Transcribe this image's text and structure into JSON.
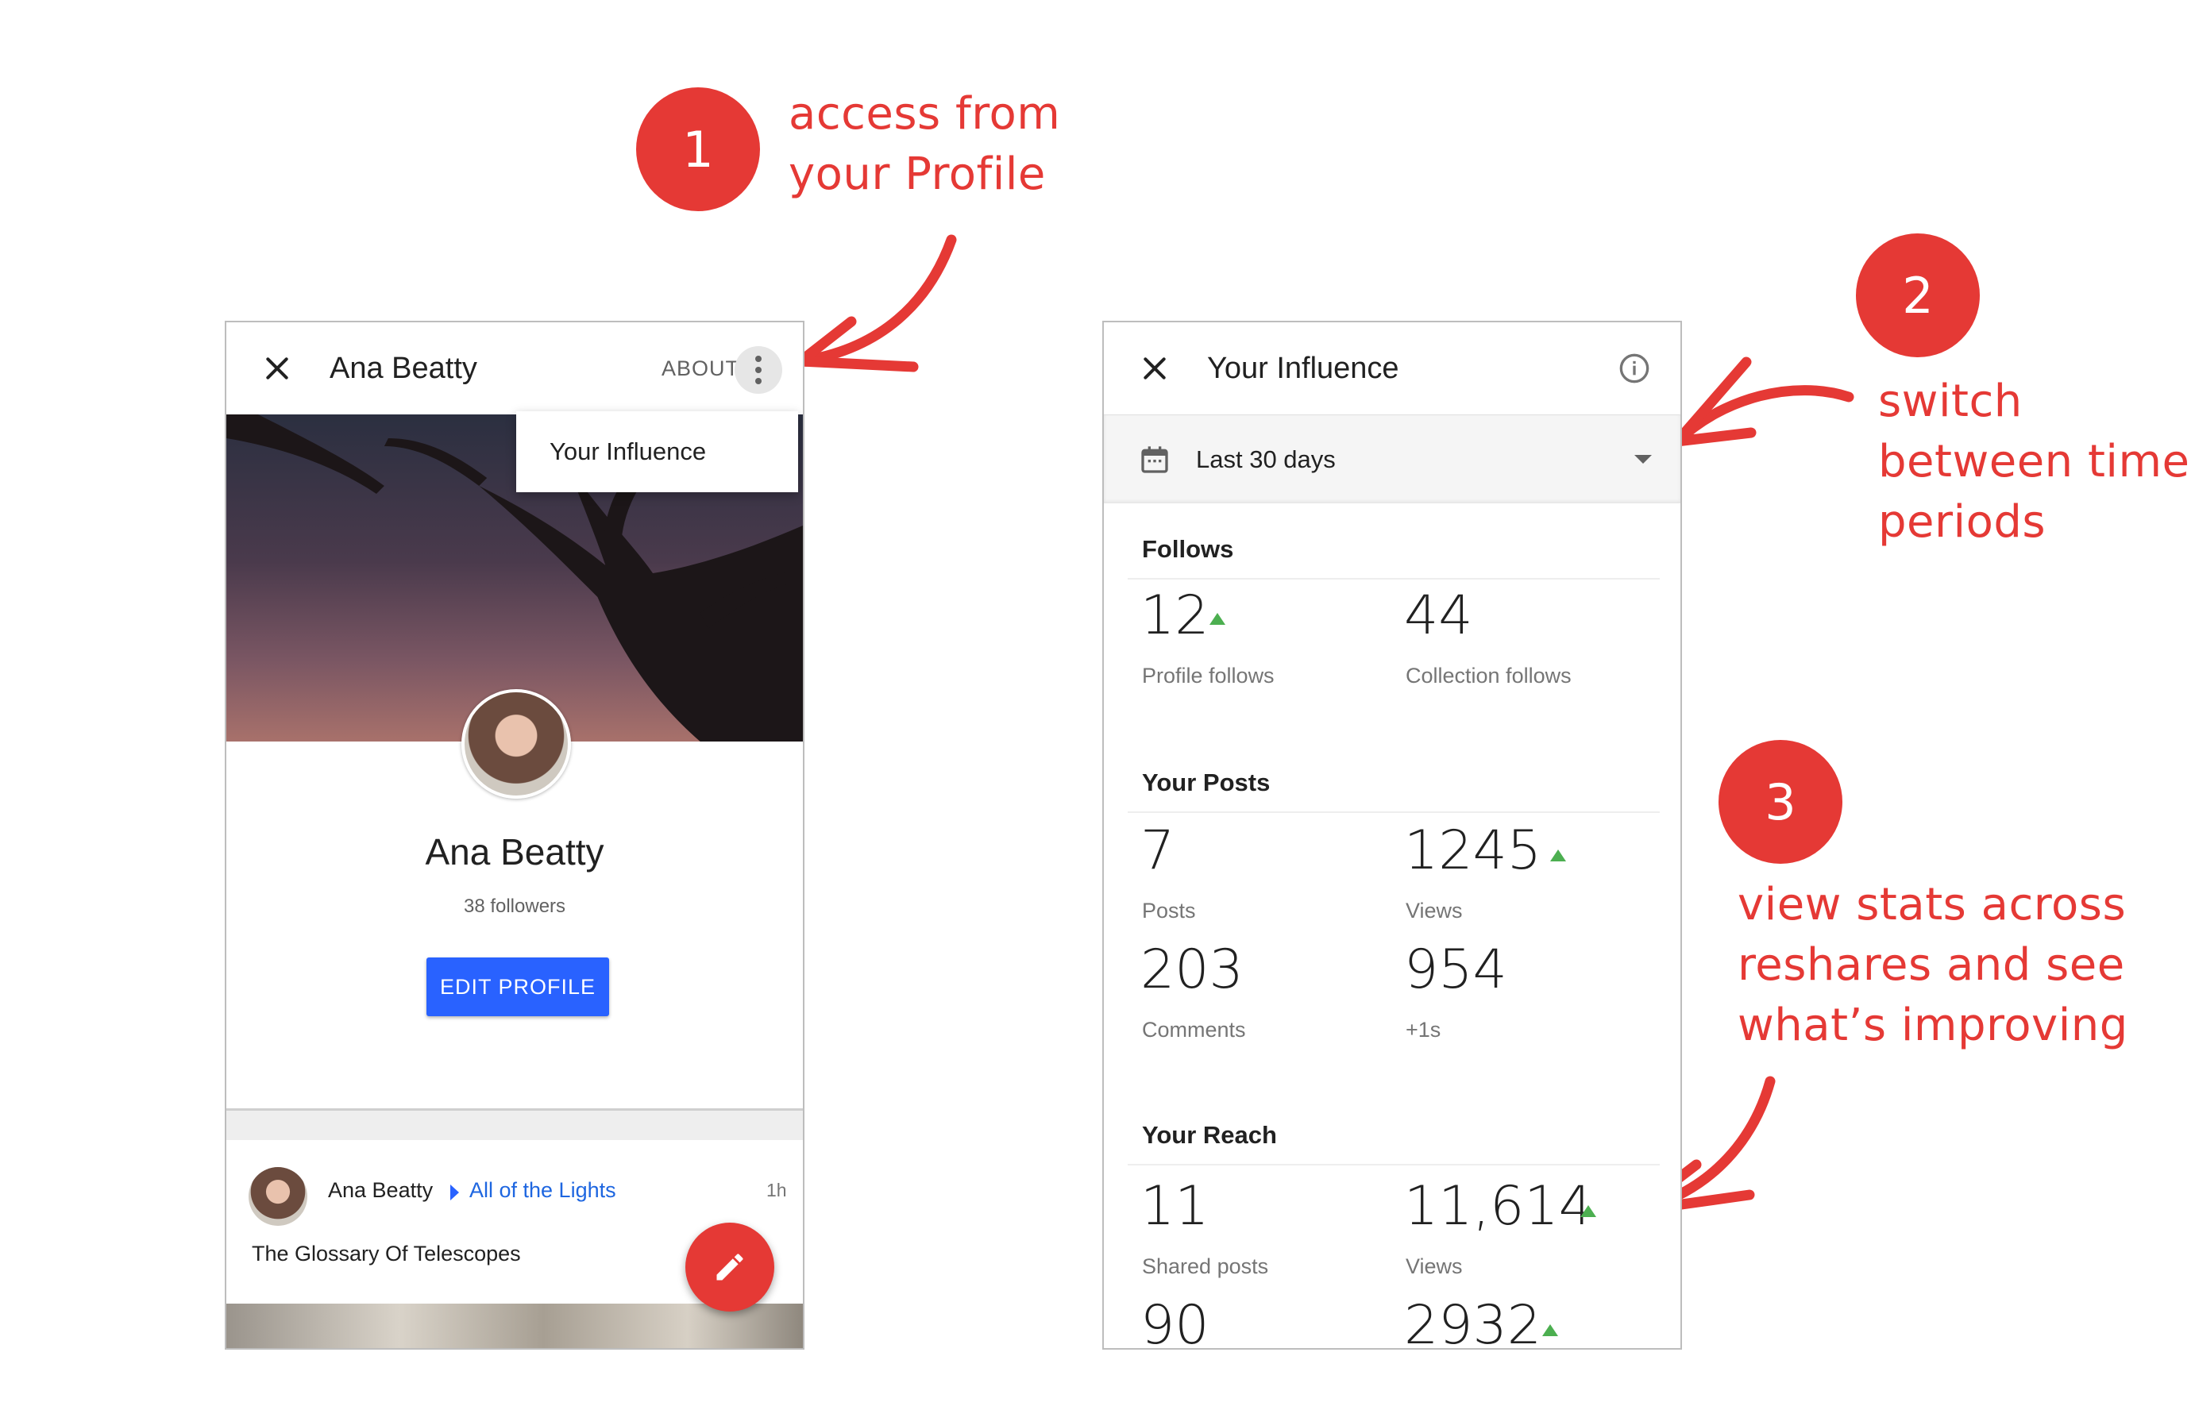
{
  "annotations": [
    {
      "number": "1",
      "caption": "access from\nyour Profile"
    },
    {
      "number": "2",
      "caption": "switch\nbetween time\nperiods"
    },
    {
      "number": "3",
      "caption": "view stats across\nreshares and see\nwhat’s improving"
    }
  ],
  "profile_screen": {
    "title": "Ana Beatty",
    "about_label": "ABOUT",
    "menu_item": "Your Influence",
    "name": "Ana Beatty",
    "followers": "38 followers",
    "edit_button": "EDIT PROFILE",
    "post": {
      "author": "Ana Beatty",
      "collection": "All of the Lights",
      "time": "1h",
      "text": "The Glossary Of Telescopes"
    }
  },
  "influence_screen": {
    "title": "Your Influence",
    "time_range": "Last 30 days",
    "follows": {
      "title": "Follows",
      "stats": [
        {
          "value": "12",
          "label": "Profile follows",
          "trend": "up"
        },
        {
          "value": "44",
          "label": "Collection follows",
          "trend": "none"
        }
      ]
    },
    "posts": {
      "title": "Your Posts",
      "stats": [
        {
          "value": "7",
          "label": "Posts",
          "trend": "none"
        },
        {
          "value": "1245",
          "label": "Views",
          "trend": "up"
        },
        {
          "value": "203",
          "label": "Comments",
          "trend": "none"
        },
        {
          "value": "954",
          "label": "+1s",
          "trend": "none"
        }
      ]
    },
    "reach": {
      "title": "Your Reach",
      "stats": [
        {
          "value": "11",
          "label": "Shared posts",
          "trend": "none"
        },
        {
          "value": "11,614",
          "label": "Views",
          "trend": "up"
        },
        {
          "value": "90",
          "label": "",
          "trend": "none"
        },
        {
          "value": "2932",
          "label": "",
          "trend": "up"
        }
      ]
    }
  },
  "colors": {
    "annotation": "#e53935",
    "primary_button": "#2962ff",
    "trend_up": "#4caf50",
    "fab": "#e53935"
  },
  "icons": [
    "close-icon",
    "more-vert-icon",
    "info-icon",
    "calendar-icon",
    "dropdown-arrow-icon",
    "edit-pencil-icon",
    "trend-up-icon"
  ]
}
